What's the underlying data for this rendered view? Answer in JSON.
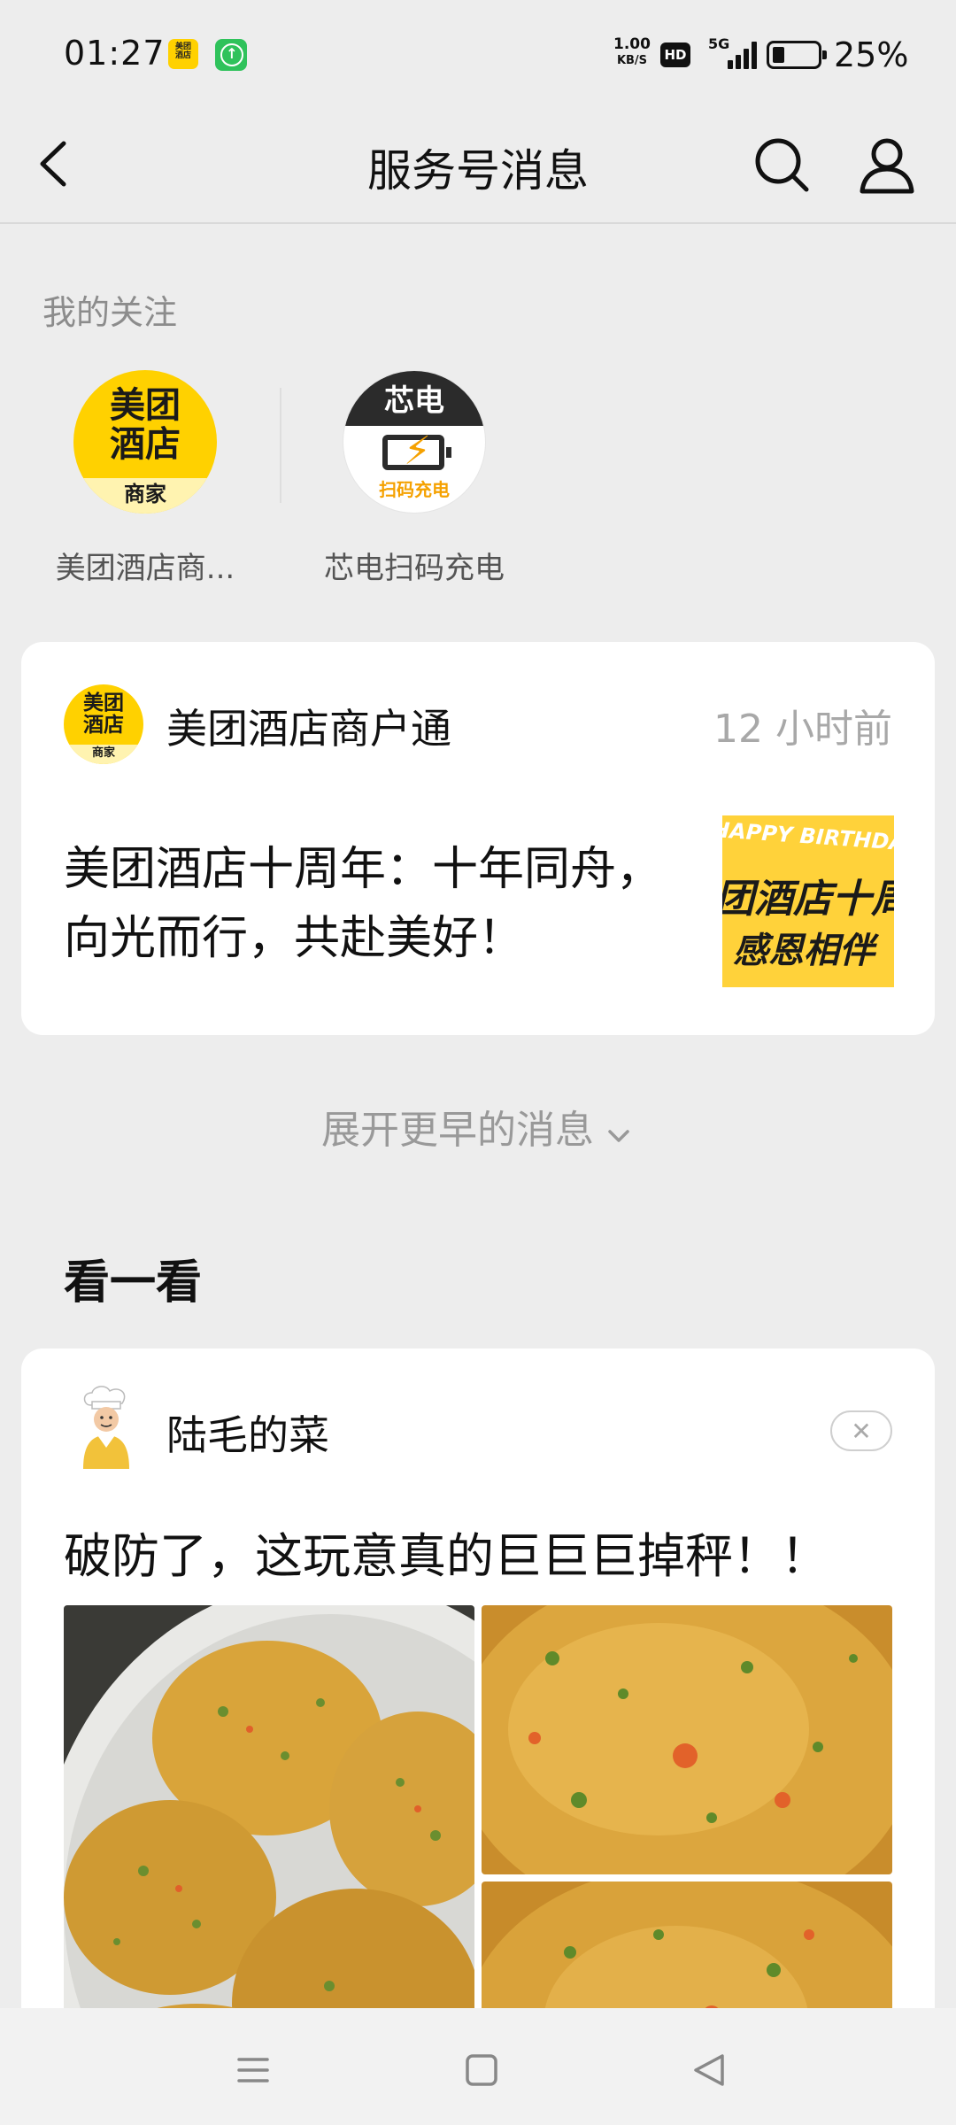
{
  "status_bar": {
    "time": "01:27",
    "app1_badge_line1": "美团",
    "app1_badge_line2": "酒店",
    "net_speed_value": "1.00",
    "net_speed_unit": "KB/S",
    "hd_label": "HD",
    "network_label": "5G",
    "battery_percent": "25%",
    "battery_level": 0.25
  },
  "nav": {
    "title": "服务号消息",
    "back_icon": "chevron-left-icon",
    "search_icon": "search-icon",
    "user_icon": "person-icon"
  },
  "following": {
    "title": "我的关注",
    "items": [
      {
        "label": "美团酒店商...",
        "logo_line1": "美团",
        "logo_line2": "酒店",
        "logo_line3": "商家"
      },
      {
        "label": "芯电扫码充电",
        "logo_top": "芯电",
        "logo_bolt": "⚡",
        "logo_bottom": "扫码充电"
      }
    ]
  },
  "message": {
    "sender": "美团酒店商户通",
    "time": "12 小时前",
    "avatar_line1": "美团",
    "avatar_line2": "酒店",
    "avatar_line3": "商家",
    "text": "美团酒店十周年：十年同舟，向光而行，共赴美好！",
    "thumb_line1": "HAPPY BIRTHDAY",
    "thumb_line2": "团酒店十周",
    "thumb_line3": "感恩相伴"
  },
  "expand_label": "展开更早的消息",
  "section_title": "看一看",
  "article": {
    "author": "陆毛的菜",
    "title": "破防了，这玩意真的巨巨巨掉秤！！",
    "close_icon": "close-icon"
  },
  "bottom_nav": {
    "menu_icon": "menu-icon",
    "home_icon": "square-home-icon",
    "back_icon": "triangle-back-icon"
  },
  "colors": {
    "background": "#ededed",
    "card": "#ffffff",
    "brand_yellow": "#ffd100",
    "muted_text": "#999999"
  }
}
